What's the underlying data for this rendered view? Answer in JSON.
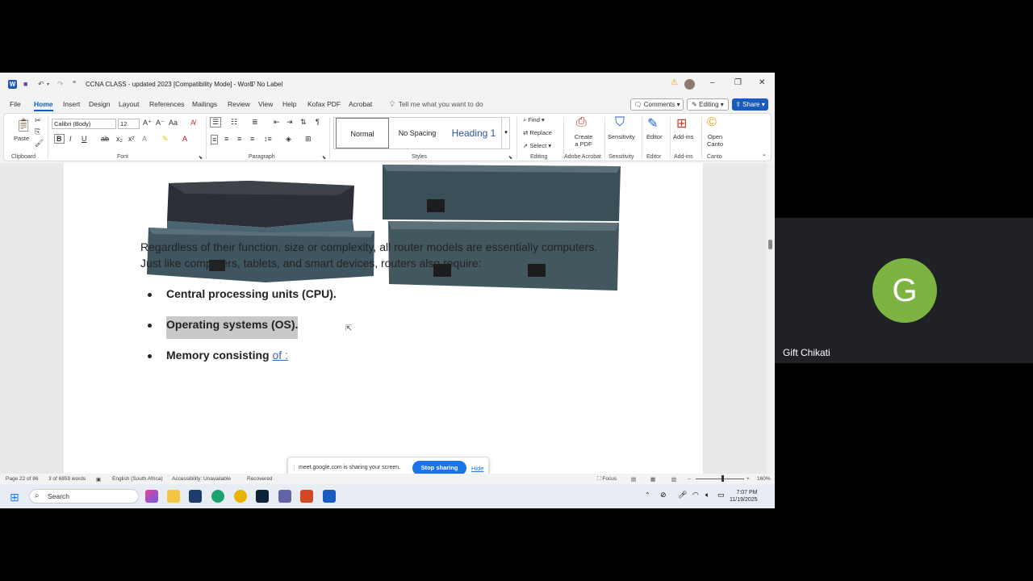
{
  "word": {
    "doc_title": "CCNA CLASS - updated 2023 [Compatibility Mode]  -  Word",
    "sensitivity_label": "No Label",
    "tabs": [
      "File",
      "Home",
      "Insert",
      "Design",
      "Layout",
      "References",
      "Mailings",
      "Review",
      "View",
      "Help",
      "Kofax PDF",
      "Acrobat"
    ],
    "tell_me": "Tell me what you want to do",
    "comments_label": "Comments",
    "editing_label": "Editing",
    "share_label": "Share",
    "ribbon": {
      "paste": "Paste",
      "font_name": "Calibri (Body)",
      "font_size": "12",
      "styles": [
        "Normal",
        "No Spacing",
        "Heading 1"
      ],
      "find": "Find",
      "replace": "Replace",
      "select": "Select",
      "create_pdf": "Create a PDF",
      "sensitivity": "Sensitivity",
      "editor": "Editor",
      "addins": "Add-ins",
      "open_canto": "Open Canto",
      "groups": {
        "clipboard": "Clipboard",
        "font": "Font",
        "paragraph": "Paragraph",
        "styles": "Styles",
        "editing": "Editing",
        "adobe": "Adobe Acrobat",
        "sensitivity": "Sensitivity",
        "editor": "Editor",
        "addins": "Add-ins",
        "canto": "Canto"
      }
    },
    "document": {
      "para_line1": "Regardless of their function, size or complexity, all router models are essentially computers.",
      "para_line2": "Just like computers, tablets, and smart devices, routers also require:",
      "bullets": [
        "Central processing units (CPU).",
        "Operating systems (OS).",
        "Memory consisting "
      ],
      "bullet3_suffix": "of :"
    },
    "status": {
      "page": "Page 22 of 86",
      "words": "3 of 6859 words",
      "language": "English (South Africa)",
      "accessibility": "Accessibility: Unavailable",
      "recovered": "Recovered",
      "focus": "Focus",
      "zoom": "160%"
    }
  },
  "screenshare": {
    "message": "meet.google.com is sharing your screen.",
    "stop": "Stop sharing",
    "hide": "Hide"
  },
  "taskbar": {
    "search_placeholder": "Search",
    "time": "7:07 PM",
    "date": "11/19/2025"
  },
  "participant": {
    "initial": "G",
    "name": "Gift Chikati",
    "avatar_color": "#7cb342"
  }
}
